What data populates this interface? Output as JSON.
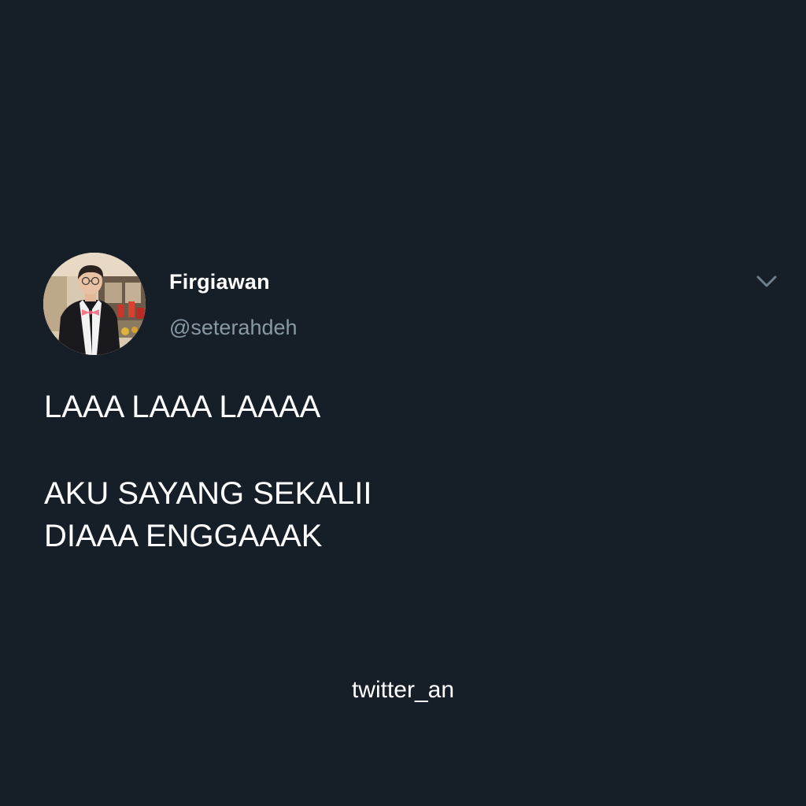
{
  "tweet": {
    "display_name": "Firgiawan",
    "handle": "@seterahdeh",
    "text_lines": [
      "LAAA LAAA LAAAA",
      "AKU SAYANG SEKALII",
      "DIAAA ENGGAAAK"
    ],
    "menu_icon": "chevron-down-icon"
  },
  "watermark": "twitter_an",
  "colors": {
    "background": "#161f28",
    "primary_text": "#ffffff",
    "secondary_text": "#8899a6"
  }
}
